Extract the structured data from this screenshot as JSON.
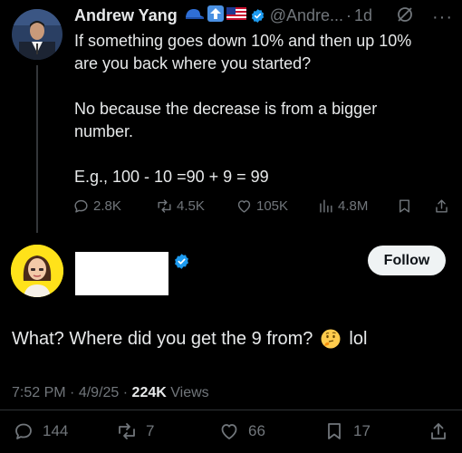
{
  "parent_tweet": {
    "author_name": "Andrew Yang",
    "handle": "@Andre...",
    "separator": "·",
    "time_ago": "1d",
    "icons": [
      "blue-cap-icon",
      "up-arrow-icon",
      "us-flag-icon",
      "verified-icon",
      "grok-icon",
      "more-icon"
    ],
    "body_lines": [
      "If something goes down 10% and then up 10%",
      "are you back where you started?",
      "",
      "No because the decrease is from a bigger",
      "number.",
      "",
      "E.g., 100 - 10 =90 + 9 = 99"
    ],
    "actions": {
      "replies": "2.8K",
      "reposts": "4.5K",
      "likes": "105K",
      "views": "4.8M"
    }
  },
  "reply_tweet": {
    "follow_label": "Follow",
    "text_before_emoji": "What? Where did you get the 9 from?",
    "emoji": "thinking-face-icon",
    "text_after_emoji": "lol",
    "time": "7:52 PM",
    "date": "4/9/25",
    "views_count": "224K",
    "views_label": "Views",
    "dot": "·",
    "actions": {
      "replies": "144",
      "reposts": "7",
      "likes": "66",
      "bookmarks": "17"
    }
  },
  "colors": {
    "background": "#000000",
    "text": "#e7e9ea",
    "muted": "#71767b",
    "verified": "#1d9bf0",
    "follow_bg": "#eff3f4"
  }
}
